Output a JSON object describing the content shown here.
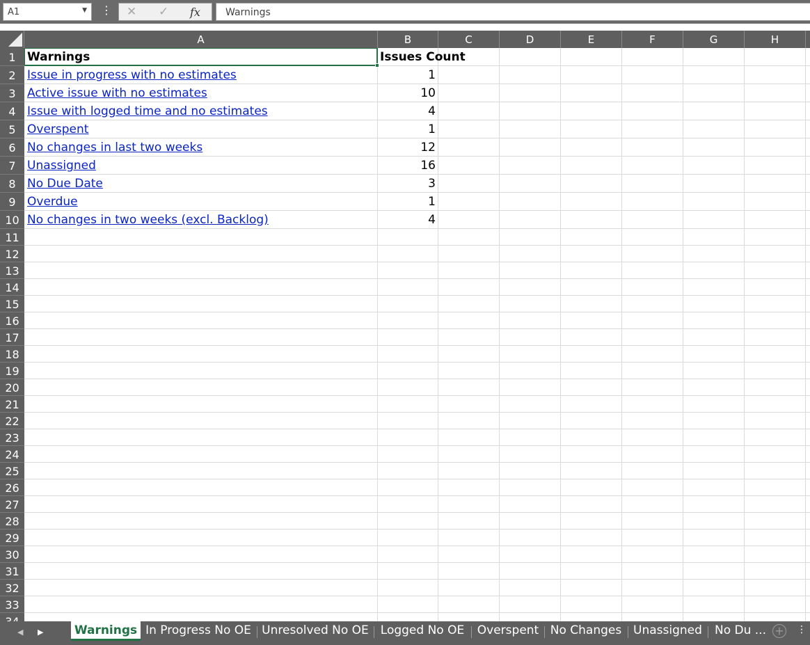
{
  "formula_bar": {
    "name_box": "A1",
    "formula": "Warnings"
  },
  "columns": [
    "A",
    "B",
    "C",
    "D",
    "E",
    "F",
    "G",
    "H"
  ],
  "rows": [
    "1",
    "2",
    "3",
    "4",
    "5",
    "6",
    "7",
    "8",
    "9",
    "10",
    "11",
    "12",
    "13",
    "14",
    "15",
    "16",
    "17",
    "18",
    "19",
    "20",
    "21",
    "22",
    "23",
    "24",
    "25",
    "26",
    "27",
    "28",
    "29",
    "30",
    "31",
    "32",
    "33",
    "34"
  ],
  "sheet": {
    "header": {
      "warnings": "Warnings",
      "issues_count": "Issues Count"
    },
    "data": [
      {
        "warning": "Issue in progress with no estimates",
        "count": "1"
      },
      {
        "warning": "Active issue with no estimates",
        "count": "10"
      },
      {
        "warning": "Issue with logged time and no estimates",
        "count": "4"
      },
      {
        "warning": "Overspent",
        "count": "1"
      },
      {
        "warning": "No changes in last two weeks",
        "count": "12"
      },
      {
        "warning": "Unassigned",
        "count": "16"
      },
      {
        "warning": "No Due Date",
        "count": "3"
      },
      {
        "warning": "Overdue",
        "count": "1"
      },
      {
        "warning": "No changes in two weeks (excl. Backlog)",
        "count": "4"
      }
    ]
  },
  "tabs": [
    {
      "label": "Warnings",
      "active": true
    },
    {
      "label": "In Progress No OE",
      "active": false
    },
    {
      "label": "Unresolved No OE",
      "active": false
    },
    {
      "label": "Logged No OE",
      "active": false
    },
    {
      "label": "Overspent",
      "active": false
    },
    {
      "label": "No Changes",
      "active": false
    },
    {
      "label": "Unassigned",
      "active": false
    },
    {
      "label": "No Du ...",
      "active": false
    }
  ],
  "colors": {
    "accent": "#217346",
    "link": "#0b24c4",
    "header_bg": "#5f5f5f",
    "gridline": "#dadada"
  }
}
